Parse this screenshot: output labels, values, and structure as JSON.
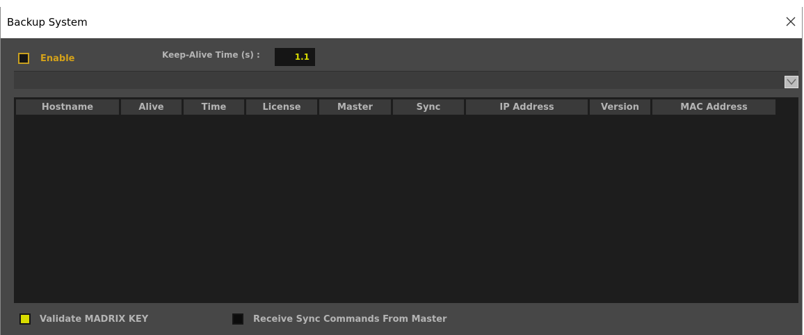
{
  "window": {
    "title": "Backup System"
  },
  "top_controls": {
    "enable_label": "Enable",
    "enable_checked": false,
    "keep_alive_label": "Keep-Alive Time (s) :",
    "keep_alive_value": "1.1"
  },
  "table": {
    "columns": [
      {
        "label": "Hostname"
      },
      {
        "label": "Alive"
      },
      {
        "label": "Time"
      },
      {
        "label": "License"
      },
      {
        "label": "Master"
      },
      {
        "label": "Sync"
      },
      {
        "label": "IP Address"
      },
      {
        "label": "Version"
      },
      {
        "label": "MAC Address"
      }
    ],
    "rows": []
  },
  "bottom_controls": {
    "validate_label": "Validate MADRIX KEY",
    "validate_checked": true,
    "receive_sync_label": "Receive Sync Commands From Master",
    "receive_sync_checked": false
  },
  "colors": {
    "accent_yellow": "#d8dc00",
    "enable_label_color": "#d4a21a",
    "panel_bg": "#474747",
    "table_bg": "#1d1d1d"
  },
  "icons": {
    "close": "close-icon",
    "dropdown": "chevron-down-icon"
  }
}
